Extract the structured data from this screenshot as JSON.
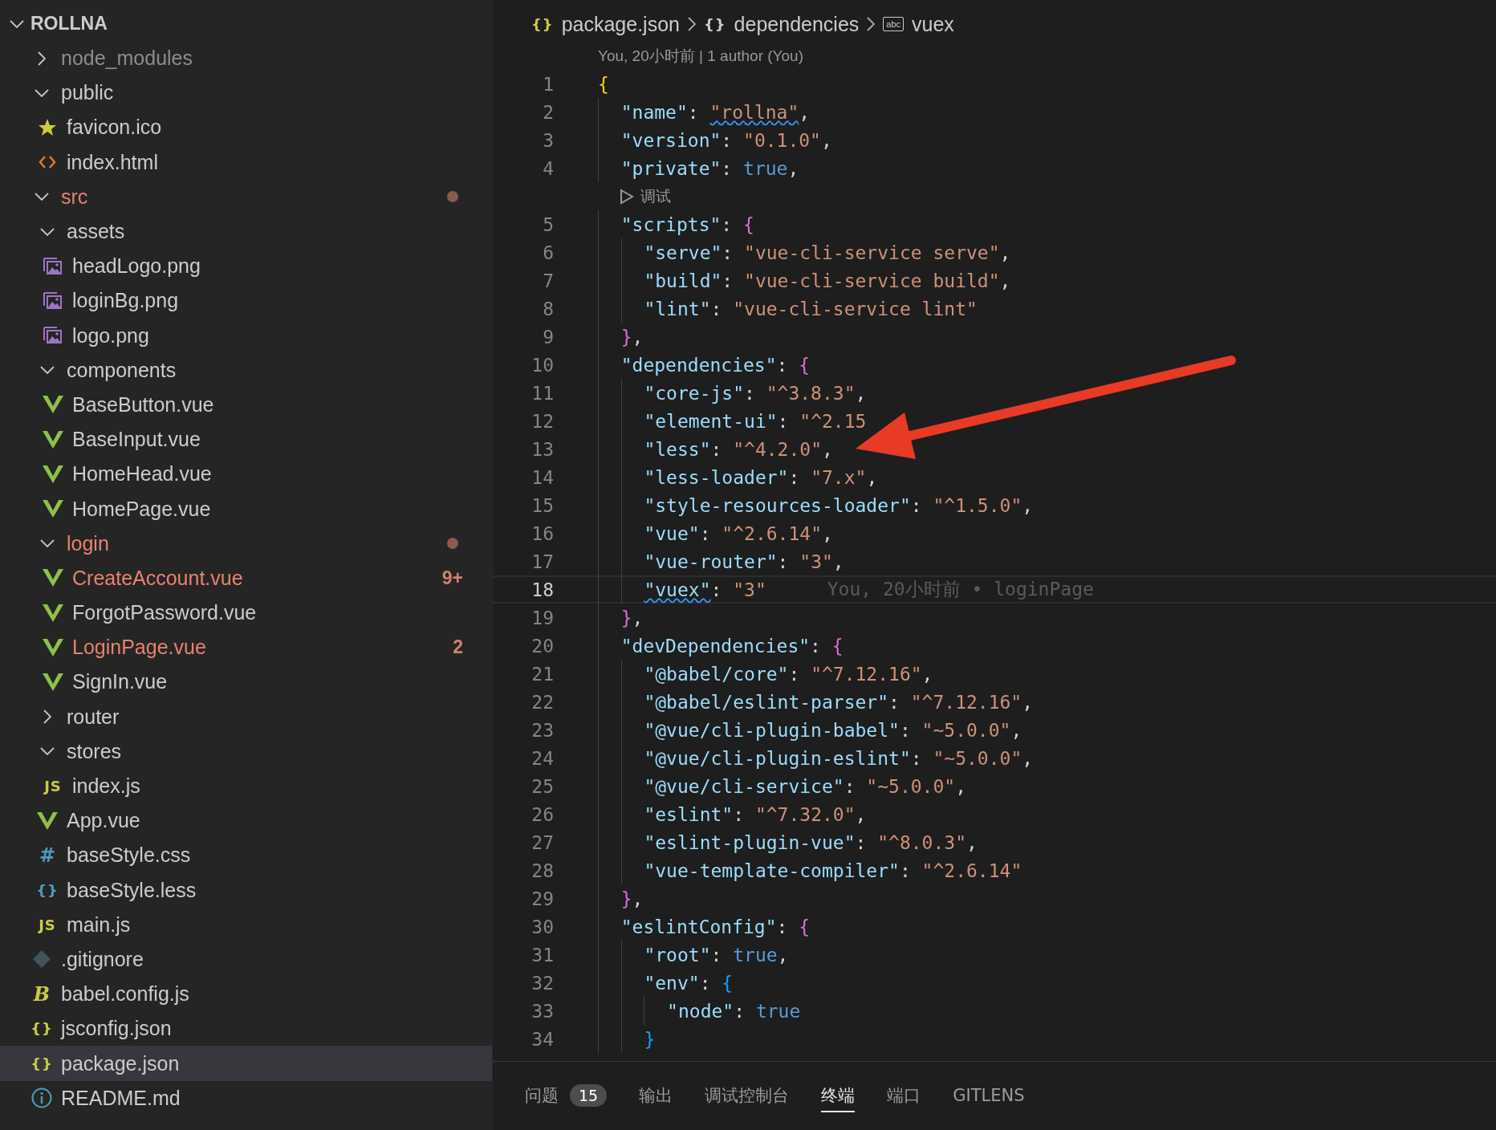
{
  "explorer": {
    "title": "ROLLNA",
    "expanded": true,
    "items": [
      {
        "kind": "folder",
        "label": "node_modules",
        "expanded": false,
        "selected": false,
        "modified": false,
        "dimmed": true
      },
      {
        "kind": "folder",
        "label": "public",
        "expanded": true,
        "selected": false,
        "modified": false,
        "dimmed": false,
        "children": [
          {
            "kind": "star",
            "label": "favicon.ico",
            "selected": false,
            "modified": false,
            "dimmed": false
          },
          {
            "kind": "html",
            "label": "index.html",
            "selected": false,
            "modified": false,
            "dimmed": false
          }
        ]
      },
      {
        "kind": "folder",
        "label": "src",
        "expanded": true,
        "selected": false,
        "modified": true,
        "dimmed": false,
        "children": [
          {
            "kind": "folder",
            "label": "assets",
            "expanded": true,
            "selected": false,
            "modified": false,
            "dimmed": false,
            "children": [
              {
                "kind": "image",
                "label": "headLogo.png",
                "selected": false,
                "modified": false,
                "dimmed": false
              },
              {
                "kind": "image",
                "label": "loginBg.png",
                "selected": false,
                "modified": false,
                "dimmed": false
              },
              {
                "kind": "image",
                "label": "logo.png",
                "selected": false,
                "modified": false,
                "dimmed": false
              }
            ]
          },
          {
            "kind": "folder",
            "label": "components",
            "expanded": true,
            "selected": false,
            "modified": false,
            "dimmed": false,
            "children": [
              {
                "kind": "vue",
                "label": "BaseButton.vue",
                "selected": false,
                "modified": false,
                "dimmed": false
              },
              {
                "kind": "vue",
                "label": "BaseInput.vue",
                "selected": false,
                "modified": false,
                "dimmed": false
              },
              {
                "kind": "vue",
                "label": "HomeHead.vue",
                "selected": false,
                "modified": false,
                "dimmed": false
              },
              {
                "kind": "vue",
                "label": "HomePage.vue",
                "selected": false,
                "modified": false,
                "dimmed": false
              }
            ]
          },
          {
            "kind": "folder",
            "label": "login",
            "expanded": true,
            "selected": false,
            "modified": true,
            "dimmed": false,
            "children": [
              {
                "kind": "vue",
                "label": "CreateAccount.vue",
                "selected": false,
                "modified": true,
                "dimmed": false,
                "badge": "9+"
              },
              {
                "kind": "vue",
                "label": "ForgotPassword.vue",
                "selected": false,
                "modified": false,
                "dimmed": false
              },
              {
                "kind": "vue",
                "label": "LoginPage.vue",
                "selected": false,
                "modified": true,
                "dimmed": false,
                "badge": "2"
              },
              {
                "kind": "vue",
                "label": "SignIn.vue",
                "selected": false,
                "modified": false,
                "dimmed": false
              }
            ]
          },
          {
            "kind": "folder",
            "label": "router",
            "expanded": false,
            "selected": false,
            "modified": false,
            "dimmed": false
          },
          {
            "kind": "folder",
            "label": "stores",
            "expanded": true,
            "selected": false,
            "modified": false,
            "dimmed": false,
            "children": [
              {
                "kind": "glyph",
                "glyph": "JS",
                "color": "#cbcb41",
                "label": "index.js",
                "selected": false,
                "modified": false,
                "dimmed": false
              }
            ]
          },
          {
            "kind": "vue",
            "label": "App.vue",
            "selected": false,
            "modified": false,
            "dimmed": false
          },
          {
            "kind": "glyph",
            "glyph": "#",
            "color": "#519aba",
            "label": "baseStyle.css",
            "selected": false,
            "modified": false,
            "dimmed": false
          },
          {
            "kind": "glyph",
            "glyph": "{}",
            "color": "#519aba",
            "label": "baseStyle.less",
            "selected": false,
            "modified": false,
            "dimmed": false
          },
          {
            "kind": "glyph",
            "glyph": "JS",
            "color": "#cbcb41",
            "label": "main.js",
            "selected": false,
            "modified": false,
            "dimmed": false
          }
        ]
      },
      {
        "kind": "git",
        "label": ".gitignore",
        "selected": false,
        "modified": false,
        "dimmed": false
      },
      {
        "kind": "glyph",
        "glyph": "B",
        "color": "#cbcb41",
        "label": "babel.config.js",
        "selected": false,
        "modified": false,
        "dimmed": false
      },
      {
        "kind": "glyph",
        "glyph": "{}",
        "color": "#cbcb41",
        "label": "jsconfig.json",
        "selected": false,
        "modified": false,
        "dimmed": false
      },
      {
        "kind": "glyph",
        "glyph": "{}",
        "color": "#cbcb41",
        "label": "package.json",
        "selected": true,
        "modified": false,
        "dimmed": false
      },
      {
        "kind": "info",
        "label": "README.md",
        "selected": false,
        "modified": false,
        "dimmed": false
      }
    ]
  },
  "breadcrumb": [
    {
      "kind": "plain",
      "glyph": "{}",
      "color": "#cbcb41",
      "label": "package.json"
    },
    {
      "kind": "plain",
      "glyph": "{}",
      "color": "#cccccc",
      "label": "dependencies"
    },
    {
      "kind": "boxed",
      "glyph": "abc",
      "color": "#cccccc",
      "label": "vuex"
    }
  ],
  "editor": {
    "lines": [
      {
        "kind": "lens",
        "text": "You, 20小时前 | 1 author (You)"
      },
      {
        "kind": "code",
        "num": "1",
        "current": false,
        "tokens": [
          {
            "kind": "brace",
            "text": "{",
            "color": "#ffd700"
          }
        ]
      },
      {
        "kind": "code",
        "num": "2",
        "current": false,
        "tokens": [
          {
            "kind": "key",
            "text": "  \"name\""
          },
          {
            "kind": "punct",
            "text": ": "
          },
          {
            "kind": "string",
            "text": "\"rollna\"",
            "squiggle": true
          },
          {
            "kind": "punct",
            "text": ","
          }
        ]
      },
      {
        "kind": "code",
        "num": "3",
        "current": false,
        "tokens": [
          {
            "kind": "key",
            "text": "  \"version\""
          },
          {
            "kind": "punct",
            "text": ": "
          },
          {
            "kind": "string",
            "text": "\"0.1.0\""
          },
          {
            "kind": "punct",
            "text": ","
          }
        ]
      },
      {
        "kind": "code",
        "num": "4",
        "current": false,
        "tokens": [
          {
            "kind": "key",
            "text": "  \"private\""
          },
          {
            "kind": "punct",
            "text": ": "
          },
          {
            "kind": "bool",
            "text": "true"
          },
          {
            "kind": "punct",
            "text": ","
          }
        ]
      },
      {
        "kind": "run",
        "text": "调试"
      },
      {
        "kind": "code",
        "num": "5",
        "current": false,
        "tokens": [
          {
            "kind": "key",
            "text": "  \"scripts\""
          },
          {
            "kind": "punct",
            "text": ": "
          },
          {
            "kind": "brace",
            "text": "{",
            "color": "#da70d6"
          }
        ]
      },
      {
        "kind": "code",
        "num": "6",
        "current": false,
        "tokens": [
          {
            "kind": "key",
            "text": "    \"serve\""
          },
          {
            "kind": "punct",
            "text": ": "
          },
          {
            "kind": "string",
            "text": "\"vue-cli-service serve\""
          },
          {
            "kind": "punct",
            "text": ","
          }
        ]
      },
      {
        "kind": "code",
        "num": "7",
        "current": false,
        "tokens": [
          {
            "kind": "key",
            "text": "    \"build\""
          },
          {
            "kind": "punct",
            "text": ": "
          },
          {
            "kind": "string",
            "text": "\"vue-cli-service build\""
          },
          {
            "kind": "punct",
            "text": ","
          }
        ]
      },
      {
        "kind": "code",
        "num": "8",
        "current": false,
        "tokens": [
          {
            "kind": "key",
            "text": "    \"lint\""
          },
          {
            "kind": "punct",
            "text": ": "
          },
          {
            "kind": "string",
            "text": "\"vue-cli-service lint\""
          }
        ]
      },
      {
        "kind": "code",
        "num": "9",
        "current": false,
        "tokens": [
          {
            "kind": "brace",
            "text": "  }",
            "color": "#da70d6"
          },
          {
            "kind": "punct",
            "text": ","
          }
        ]
      },
      {
        "kind": "code",
        "num": "10",
        "current": false,
        "tokens": [
          {
            "kind": "key",
            "text": "  \"dependencies\""
          },
          {
            "kind": "punct",
            "text": ": "
          },
          {
            "kind": "brace",
            "text": "{",
            "color": "#da70d6"
          }
        ]
      },
      {
        "kind": "code",
        "num": "11",
        "current": false,
        "tokens": [
          {
            "kind": "key",
            "text": "    \"core-js\""
          },
          {
            "kind": "punct",
            "text": ": "
          },
          {
            "kind": "string",
            "text": "\"^3.8.3\""
          },
          {
            "kind": "punct",
            "text": ","
          }
        ]
      },
      {
        "kind": "code",
        "num": "12",
        "current": false,
        "tokens": [
          {
            "kind": "key",
            "text": "    \"element-ui\""
          },
          {
            "kind": "punct",
            "text": ": "
          },
          {
            "kind": "string",
            "text": "\"^2.15"
          }
        ]
      },
      {
        "kind": "code",
        "num": "13",
        "current": false,
        "tokens": [
          {
            "kind": "key",
            "text": "    \"less\""
          },
          {
            "kind": "punct",
            "text": ": "
          },
          {
            "kind": "string",
            "text": "\"^4.2.0\""
          },
          {
            "kind": "punct",
            "text": ","
          }
        ]
      },
      {
        "kind": "code",
        "num": "14",
        "current": false,
        "tokens": [
          {
            "kind": "key",
            "text": "    \"less-loader\""
          },
          {
            "kind": "punct",
            "text": ": "
          },
          {
            "kind": "string",
            "text": "\"7.x\""
          },
          {
            "kind": "punct",
            "text": ","
          }
        ]
      },
      {
        "kind": "code",
        "num": "15",
        "current": false,
        "tokens": [
          {
            "kind": "key",
            "text": "    \"style-resources-loader\""
          },
          {
            "kind": "punct",
            "text": ": "
          },
          {
            "kind": "string",
            "text": "\"^1.5.0\""
          },
          {
            "kind": "punct",
            "text": ","
          }
        ]
      },
      {
        "kind": "code",
        "num": "16",
        "current": false,
        "tokens": [
          {
            "kind": "key",
            "text": "    \"vue\""
          },
          {
            "kind": "punct",
            "text": ": "
          },
          {
            "kind": "string",
            "text": "\"^2.6.14\""
          },
          {
            "kind": "punct",
            "text": ","
          }
        ]
      },
      {
        "kind": "code",
        "num": "17",
        "current": false,
        "tokens": [
          {
            "kind": "key",
            "text": "    \"vue-router\""
          },
          {
            "kind": "punct",
            "text": ": "
          },
          {
            "kind": "string",
            "text": "\"3\""
          },
          {
            "kind": "punct",
            "text": ","
          }
        ]
      },
      {
        "kind": "code",
        "num": "18",
        "current": true,
        "blame": "You, 20小时前 • loginPage",
        "tokens": [
          {
            "kind": "key",
            "text": "    \"vuex\"",
            "squiggle": true
          },
          {
            "kind": "punct",
            "text": ": "
          },
          {
            "kind": "string",
            "text": "\"3\""
          }
        ]
      },
      {
        "kind": "code",
        "num": "19",
        "current": false,
        "tokens": [
          {
            "kind": "brace",
            "text": "  }",
            "color": "#da70d6"
          },
          {
            "kind": "punct",
            "text": ","
          }
        ]
      },
      {
        "kind": "code",
        "num": "20",
        "current": false,
        "tokens": [
          {
            "kind": "key",
            "text": "  \"devDependencies\""
          },
          {
            "kind": "punct",
            "text": ": "
          },
          {
            "kind": "brace",
            "text": "{",
            "color": "#da70d6"
          }
        ]
      },
      {
        "kind": "code",
        "num": "21",
        "current": false,
        "tokens": [
          {
            "kind": "key",
            "text": "    \"@babel/core\""
          },
          {
            "kind": "punct",
            "text": ": "
          },
          {
            "kind": "string",
            "text": "\"^7.12.16\""
          },
          {
            "kind": "punct",
            "text": ","
          }
        ]
      },
      {
        "kind": "code",
        "num": "22",
        "current": false,
        "tokens": [
          {
            "kind": "key",
            "text": "    \"@babel/eslint-parser\""
          },
          {
            "kind": "punct",
            "text": ": "
          },
          {
            "kind": "string",
            "text": "\"^7.12.16\""
          },
          {
            "kind": "punct",
            "text": ","
          }
        ]
      },
      {
        "kind": "code",
        "num": "23",
        "current": false,
        "tokens": [
          {
            "kind": "key",
            "text": "    \"@vue/cli-plugin-babel\""
          },
          {
            "kind": "punct",
            "text": ": "
          },
          {
            "kind": "string",
            "text": "\"~5.0.0\""
          },
          {
            "kind": "punct",
            "text": ","
          }
        ]
      },
      {
        "kind": "code",
        "num": "24",
        "current": false,
        "tokens": [
          {
            "kind": "key",
            "text": "    \"@vue/cli-plugin-eslint\""
          },
          {
            "kind": "punct",
            "text": ": "
          },
          {
            "kind": "string",
            "text": "\"~5.0.0\""
          },
          {
            "kind": "punct",
            "text": ","
          }
        ]
      },
      {
        "kind": "code",
        "num": "25",
        "current": false,
        "tokens": [
          {
            "kind": "key",
            "text": "    \"@vue/cli-service\""
          },
          {
            "kind": "punct",
            "text": ": "
          },
          {
            "kind": "string",
            "text": "\"~5.0.0\""
          },
          {
            "kind": "punct",
            "text": ","
          }
        ]
      },
      {
        "kind": "code",
        "num": "26",
        "current": false,
        "tokens": [
          {
            "kind": "key",
            "text": "    \"eslint\""
          },
          {
            "kind": "punct",
            "text": ": "
          },
          {
            "kind": "string",
            "text": "\"^7.32.0\""
          },
          {
            "kind": "punct",
            "text": ","
          }
        ]
      },
      {
        "kind": "code",
        "num": "27",
        "current": false,
        "tokens": [
          {
            "kind": "key",
            "text": "    \"eslint-plugin-vue\""
          },
          {
            "kind": "punct",
            "text": ": "
          },
          {
            "kind": "string",
            "text": "\"^8.0.3\""
          },
          {
            "kind": "punct",
            "text": ","
          }
        ]
      },
      {
        "kind": "code",
        "num": "28",
        "current": false,
        "tokens": [
          {
            "kind": "key",
            "text": "    \"vue-template-compiler\""
          },
          {
            "kind": "punct",
            "text": ": "
          },
          {
            "kind": "string",
            "text": "\"^2.6.14\""
          }
        ]
      },
      {
        "kind": "code",
        "num": "29",
        "current": false,
        "tokens": [
          {
            "kind": "brace",
            "text": "  }",
            "color": "#da70d6"
          },
          {
            "kind": "punct",
            "text": ","
          }
        ]
      },
      {
        "kind": "code",
        "num": "30",
        "current": false,
        "tokens": [
          {
            "kind": "key",
            "text": "  \"eslintConfig\""
          },
          {
            "kind": "punct",
            "text": ": "
          },
          {
            "kind": "brace",
            "text": "{",
            "color": "#da70d6"
          }
        ]
      },
      {
        "kind": "code",
        "num": "31",
        "current": false,
        "tokens": [
          {
            "kind": "key",
            "text": "    \"root\""
          },
          {
            "kind": "punct",
            "text": ": "
          },
          {
            "kind": "bool",
            "text": "true"
          },
          {
            "kind": "punct",
            "text": ","
          }
        ]
      },
      {
        "kind": "code",
        "num": "32",
        "current": false,
        "tokens": [
          {
            "kind": "key",
            "text": "    \"env\""
          },
          {
            "kind": "punct",
            "text": ": "
          },
          {
            "kind": "brace",
            "text": "{",
            "color": "#179fff"
          }
        ]
      },
      {
        "kind": "code",
        "num": "33",
        "current": false,
        "tokens": [
          {
            "kind": "key",
            "text": "      \"node\""
          },
          {
            "kind": "punct",
            "text": ": "
          },
          {
            "kind": "bool",
            "text": "true"
          }
        ]
      },
      {
        "kind": "code",
        "num": "34",
        "current": false,
        "tokens": [
          {
            "kind": "brace",
            "text": "    }",
            "color": "#179fff"
          }
        ]
      }
    ]
  },
  "panel": {
    "tabs": [
      {
        "label": "问题",
        "selected": false,
        "badge": "15"
      },
      {
        "label": "输出",
        "selected": false
      },
      {
        "label": "调试控制台",
        "selected": false
      },
      {
        "label": "终端",
        "selected": true
      },
      {
        "label": "端口",
        "selected": false
      },
      {
        "label": "GITLENS",
        "selected": false
      }
    ]
  }
}
